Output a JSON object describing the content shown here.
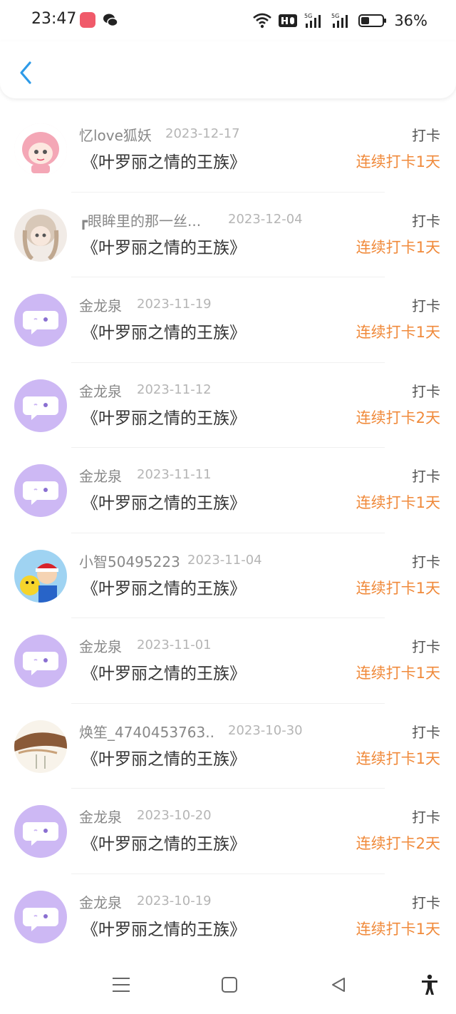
{
  "status": {
    "time": "23:47",
    "battery": "36%"
  },
  "items": [
    {
      "name": "忆love狐妖",
      "date": "2023-12-17",
      "book": "《叶罗丽之情的王族》",
      "type": "打卡",
      "streak": "连续打卡1天"
    },
    {
      "name": "┏眼眸里的那一丝...",
      "date": "2023-12-04",
      "book": "《叶罗丽之情的王族》",
      "type": "打卡",
      "streak": "连续打卡1天"
    },
    {
      "name": "金龙泉",
      "date": "2023-11-19",
      "book": "《叶罗丽之情的王族》",
      "type": "打卡",
      "streak": "连续打卡1天"
    },
    {
      "name": "金龙泉",
      "date": "2023-11-12",
      "book": "《叶罗丽之情的王族》",
      "type": "打卡",
      "streak": "连续打卡2天"
    },
    {
      "name": "金龙泉",
      "date": "2023-11-11",
      "book": "《叶罗丽之情的王族》",
      "type": "打卡",
      "streak": "连续打卡1天"
    },
    {
      "name": "小智50495223",
      "date": "2023-11-04",
      "book": "《叶罗丽之情的王族》",
      "type": "打卡",
      "streak": "连续打卡1天"
    },
    {
      "name": "金龙泉",
      "date": "2023-11-01",
      "book": "《叶罗丽之情的王族》",
      "type": "打卡",
      "streak": "连续打卡1天"
    },
    {
      "name": "焕笙_4740453763...",
      "date": "2023-10-30",
      "book": "《叶罗丽之情的王族》",
      "type": "打卡",
      "streak": "连续打卡1天"
    },
    {
      "name": "金龙泉",
      "date": "2023-10-20",
      "book": "《叶罗丽之情的王族》",
      "type": "打卡",
      "streak": "连续打卡2天"
    },
    {
      "name": "金龙泉",
      "date": "2023-10-19",
      "book": "《叶罗丽之情的王族》",
      "type": "打卡",
      "streak": "连续打卡1天"
    }
  ]
}
